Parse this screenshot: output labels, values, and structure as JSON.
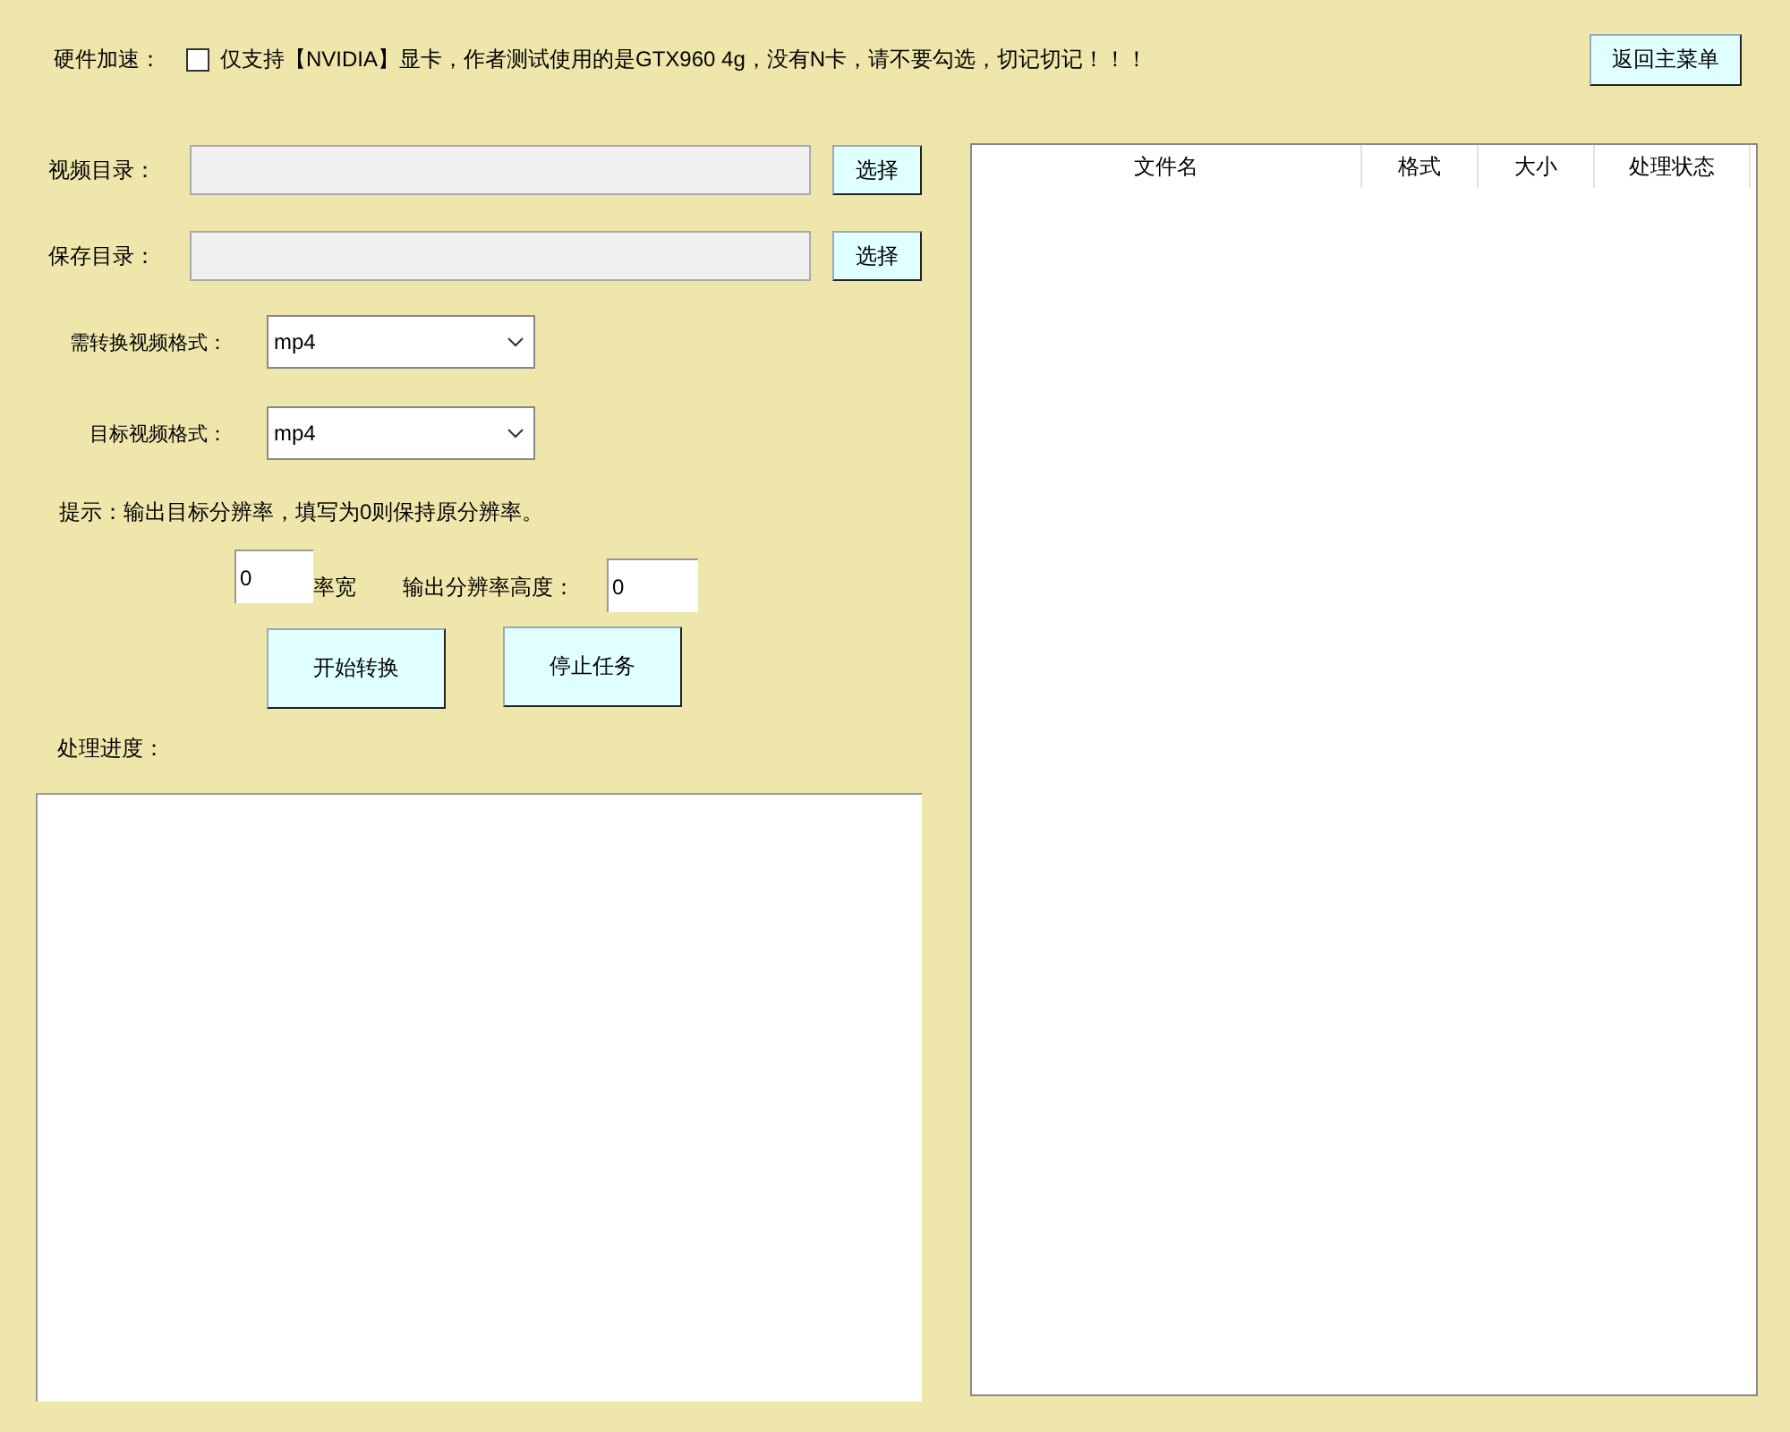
{
  "hardware_accel": {
    "label": "硬件加速：",
    "checked": false,
    "note": "仅支持【NVIDIA】显卡，作者测试使用的是GTX960 4g，没有N卡，请不要勾选，切记切记！！！"
  },
  "back_button": "返回主菜单",
  "video_dir": {
    "label": "视频目录：",
    "button": "选择"
  },
  "save_dir": {
    "label": "保存目录：",
    "button": "选择"
  },
  "source_format": {
    "label": "需转换视频格式：",
    "value": "mp4"
  },
  "target_format": {
    "label": "目标视频格式：",
    "value": "mp4"
  },
  "hint": "提示：输出目标分辨率，填写为0则保持原分辨率。",
  "width": {
    "value": "0",
    "label": "率宽"
  },
  "height": {
    "label": "输出分辨率高度：",
    "value": "0"
  },
  "start_button": "开始转换",
  "stop_button": "停止任务",
  "progress_label": "处理进度：",
  "file_table": {
    "columns": [
      "文件名",
      "格式",
      "大小",
      "处理状态"
    ]
  }
}
